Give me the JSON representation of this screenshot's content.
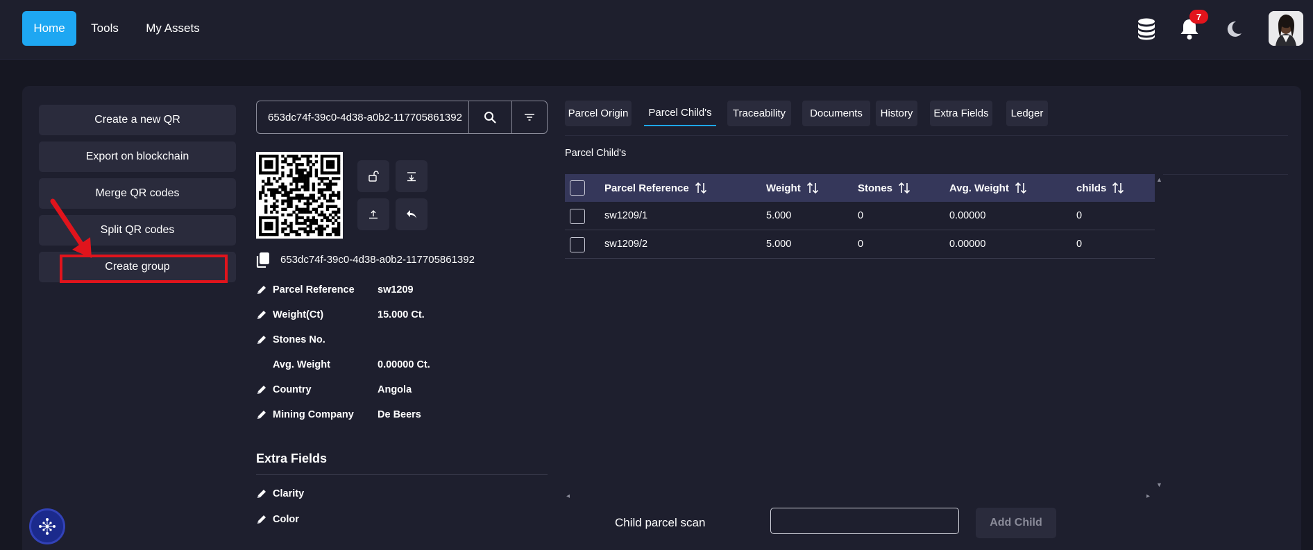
{
  "nav": {
    "home": "Home",
    "tools": "Tools",
    "my_assets": "My Assets",
    "notifications_count": "7",
    "icons": [
      "database-icon",
      "bell-icon",
      "moon-icon"
    ]
  },
  "actions": {
    "create_qr": "Create a new QR",
    "export_blockchain": "Export on blockchain",
    "merge_qr": "Merge QR codes",
    "split_qr": "Split QR codes",
    "create_group": "Create group"
  },
  "search": {
    "value": "653dc74f-39c0-4d38-a0b2-117705861392"
  },
  "parcel": {
    "uuid": "653dc74f-39c0-4d38-a0b2-117705861392",
    "fields": [
      {
        "label": "Parcel Reference",
        "value": "sw1209"
      },
      {
        "label": "Weight(Ct)",
        "value": "15.000 Ct."
      },
      {
        "label": "Stones No.",
        "value": ""
      },
      {
        "label": "Avg. Weight",
        "value": "0.00000 Ct."
      },
      {
        "label": "Country",
        "value": "Angola"
      },
      {
        "label": "Mining Company",
        "value": "De Beers"
      }
    ]
  },
  "extra_fields": {
    "title": "Extra Fields",
    "items": [
      "Clarity",
      "Color"
    ]
  },
  "tabs": [
    "Parcel Origin",
    "Parcel Child's",
    "Traceability",
    "Documents",
    "History",
    "Extra Fields",
    "Ledger"
  ],
  "active_tab": "Parcel Child's",
  "section_title": "Parcel Child's",
  "table": {
    "headers": [
      "Parcel Reference",
      "Weight",
      "Stones",
      "Avg. Weight",
      "childs"
    ],
    "rows": [
      [
        "sw1209/1",
        "5.000",
        "0",
        "0.00000",
        "0"
      ],
      [
        "sw1209/2",
        "5.000",
        "0",
        "0.00000",
        "0"
      ]
    ]
  },
  "scan": {
    "label": "Child parcel scan",
    "button": "Add Child"
  },
  "colors": {
    "accent": "#1ea7f2",
    "annotation_red": "#e0141c",
    "badge_red": "#e3141c",
    "panel": "#1e1f2e",
    "table_header": "#35375a"
  }
}
